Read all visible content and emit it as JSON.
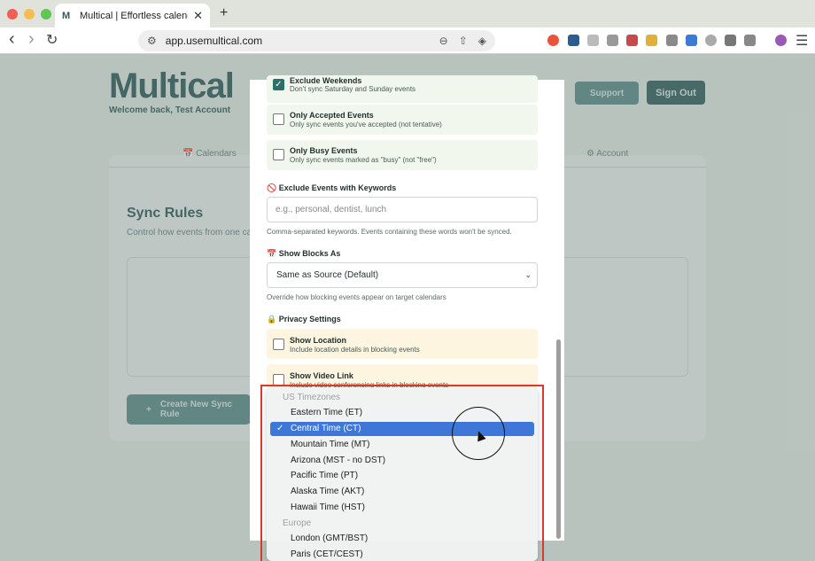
{
  "browser": {
    "tab_title": "Multical | Effortless calendar s",
    "tab_close": "✕",
    "new_tab": "+",
    "url": "app.usemultical.com",
    "back": "‹",
    "forward": "›",
    "reload": "↻"
  },
  "page": {
    "logo": "Multical",
    "welcome": "Welcome back, Test Account",
    "support_label": "Support",
    "signout_label": "Sign Out",
    "nav_calendars": "📅 Calendars",
    "nav_account": "⚙ Account",
    "sync_title": "Sync Rules",
    "sync_sub": "Control how events from one cale",
    "create_label": "Create New Sync Rule"
  },
  "modal": {
    "exclude_weekends_label": "Exclude Weekends",
    "exclude_weekends_desc": "Don't sync Saturday and Sunday events",
    "only_accepted_label": "Only Accepted Events",
    "only_accepted_desc": "Only sync events you've accepted (not tentative)",
    "only_busy_label": "Only Busy Events",
    "only_busy_desc": "Only sync events marked as \"busy\" (not \"free\")",
    "keywords_title": "🚫 Exclude Events with Keywords",
    "keywords_placeholder": "e.g., personal, dentist, lunch",
    "keywords_help": "Comma-separated keywords. Events containing these words won't be synced.",
    "show_blocks_title": "📅 Show Blocks As",
    "show_blocks_value": "Same as Source (Default)",
    "show_blocks_help": "Override how blocking events appear on target calendars",
    "privacy_title": "🔒 Privacy Settings",
    "show_location_label": "Show Location",
    "show_location_desc": "Include location details in blocking events",
    "show_video_label": "Show Video Link",
    "show_video_desc": "Include video conferencing links in blocking events"
  },
  "dropdown": {
    "group_us": "US Timezones",
    "items_us": [
      "Eastern Time (ET)",
      "Central Time (CT)",
      "Mountain Time (MT)",
      "Arizona (MST - no DST)",
      "Pacific Time (PT)",
      "Alaska Time (AKT)",
      "Hawaii Time (HST)"
    ],
    "selected": "Central Time (CT)",
    "group_eu": "Europe",
    "items_eu": [
      "London (GMT/BST)",
      "Paris (CET/CEST)"
    ]
  },
  "colors": {
    "accent": "#2f5c5b",
    "selection": "#3f77d8",
    "highlight": "#d63b2d"
  }
}
